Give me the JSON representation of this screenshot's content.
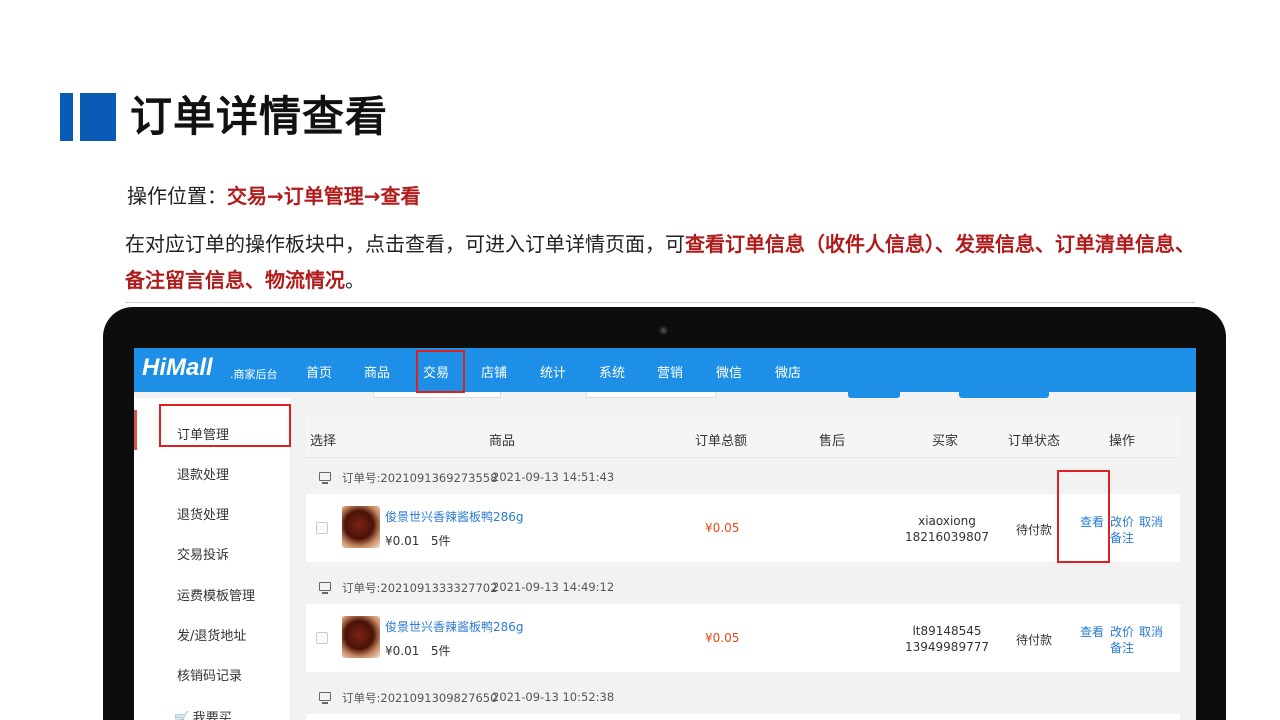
{
  "title": "订单详情查看",
  "op_location": {
    "label": "操作位置：",
    "path": "交易→订单管理→查看"
  },
  "description": {
    "prefix": "在对应订单的操作板块中，点击查看，可进入订单详情页面，可",
    "highlight": "查看订单信息（收件人信息）、发票信息、订单清单信息、备注留言信息、物流情况",
    "suffix": "。"
  },
  "app": {
    "logo": "HiMall",
    "logo_sub": ".商家后台",
    "nav": [
      "首页",
      "商品",
      "交易",
      "店铺",
      "统计",
      "系统",
      "营销",
      "微信",
      "微店"
    ],
    "active_nav": "交易"
  },
  "sidebar": {
    "items": [
      "订单管理",
      "退款处理",
      "退货处理",
      "交易投诉",
      "运费模板管理",
      "发/退货地址",
      "核销码记录",
      "我要买"
    ],
    "active": "订单管理"
  },
  "table": {
    "headers": [
      "选择",
      "商品",
      "订单总额",
      "售后",
      "买家",
      "订单状态",
      "操作"
    ]
  },
  "orders": [
    {
      "order_no": "订单号:2021091369273558",
      "time": "2021-09-13 14:51:43",
      "product": "俊景世兴香辣酱板鸭286g",
      "price": "¥0.01",
      "qty": "5件",
      "total": "¥0.05",
      "buyer_name": "xiaoxiong",
      "buyer_phone": "18216039807",
      "status": "待付款",
      "actions": {
        "view": "查看",
        "reprice": "改价",
        "cancel": "取消",
        "note": "备注"
      }
    },
    {
      "order_no": "订单号:2021091333327702",
      "time": "2021-09-13 14:49:12",
      "product": "俊景世兴香辣酱板鸭286g",
      "price": "¥0.01",
      "qty": "5件",
      "total": "¥0.05",
      "buyer_name": "lt89148545",
      "buyer_phone": "13949989777",
      "status": "待付款",
      "actions": {
        "view": "查看",
        "reprice": "改价",
        "cancel": "取消",
        "note": "备注"
      }
    },
    {
      "order_no": "订单号:2021091309827650",
      "time": "2021-09-13 10:52:38"
    }
  ],
  "colors": {
    "brand_blue": "#1d8fe6",
    "title_blue": "#0a5bb5",
    "highlight_red": "#b01c1c",
    "annotation_red": "#e02020",
    "price_orange": "#e64a19",
    "link_blue": "#2a7bd4"
  }
}
